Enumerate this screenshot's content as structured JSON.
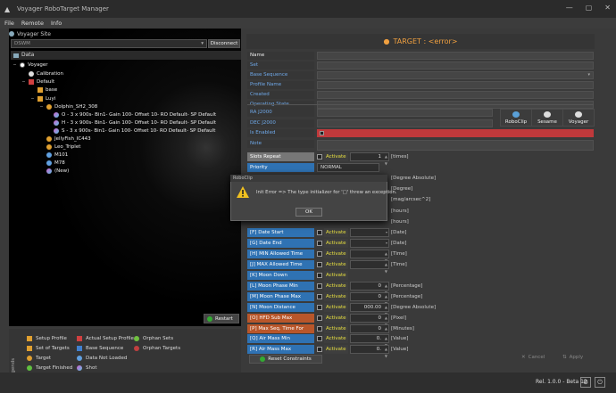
{
  "window": {
    "title": "Voyager RoboTarget Manager"
  },
  "menu": [
    "File",
    "Remote",
    "Info"
  ],
  "site": {
    "label": "Voyager Site",
    "combo_value": "DSWM",
    "disconnect_label": "Disconnect"
  },
  "data_header": "Data",
  "tree": [
    {
      "label": "Voyager",
      "indent": 0
    },
    {
      "label": "Calibration",
      "indent": 1
    },
    {
      "label": "Default",
      "indent": 1
    },
    {
      "label": "base",
      "indent": 2
    },
    {
      "label": "Luyi",
      "indent": 2
    },
    {
      "label": "Dolphin_SH2_308",
      "indent": 3
    },
    {
      "label": "O - 3 x 900s- Bin1- Gain 100- Offset 10- RO Default- SP Default",
      "indent": 4
    },
    {
      "label": "H - 3 x 900s- Bin1- Gain 100- Offset 10- RO Default- SP Default",
      "indent": 4
    },
    {
      "label": "S - 3 x 900s- Bin1- Gain 100- Offset 10- RO Default- SP Default",
      "indent": 4
    },
    {
      "label": "JellyFish_IC443",
      "indent": 3
    },
    {
      "label": "Leo_Triplet",
      "indent": 3
    },
    {
      "label": "M101",
      "indent": 3
    },
    {
      "label": "M78",
      "indent": 3
    },
    {
      "label": "(New)",
      "indent": 3
    }
  ],
  "restart_label": "Restart",
  "legend": {
    "title": "Legends",
    "items": [
      {
        "label": "Setup Profile",
        "color": "#e0a030"
      },
      {
        "label": "Actual Setup Profile",
        "color": "#d04040"
      },
      {
        "label": "Orphan Sets",
        "color": "#70c040"
      },
      {
        "label": "Set of Targets",
        "color": "#e0a030"
      },
      {
        "label": "Base Sequence",
        "color": "#4080d0"
      },
      {
        "label": "Orphan Targets",
        "color": "#c04040"
      },
      {
        "label": "Target",
        "color": "#e0a030"
      },
      {
        "label": "Data Not Loaded",
        "color": "#60a0e0"
      },
      {
        "label": "Target Finished",
        "color": "#60c040"
      },
      {
        "label": "Shot",
        "color": "#d060d0"
      }
    ]
  },
  "target_header": "TARGET : <error>",
  "fields": [
    {
      "label": "Name",
      "white": true
    },
    {
      "label": "Set",
      "white": false
    },
    {
      "label": "Base Sequence",
      "white": false
    },
    {
      "label": "Profile Name",
      "white": false
    },
    {
      "label": "Created",
      "white": false
    },
    {
      "label": "Operating State",
      "white": false
    }
  ],
  "coords": {
    "ra": "RA J2000",
    "dec": "DEC J2000"
  },
  "tools": [
    "RoboClip",
    "Sesame",
    "Voyager"
  ],
  "is_enabled": "Is Enabled",
  "note": "Note",
  "slots_repeat": {
    "label": "Slots Repeat",
    "activate": "Activate",
    "value": "1",
    "unit": "[times]"
  },
  "priority": {
    "label": "Priority",
    "value": "NORMAL"
  },
  "hidden_units": [
    "[Degree Absolute]",
    "[Degree]",
    "[mag/arcsec^2]",
    "[hours]",
    "[hours]"
  ],
  "constraints": [
    {
      "label": "[F] Date Start",
      "activate": "Activate",
      "value": "",
      "unit": "[Date]",
      "style": "blue"
    },
    {
      "label": "[G] Date End",
      "activate": "Activate",
      "value": "",
      "unit": "[Date]",
      "style": "blue"
    },
    {
      "label": "[H] MIN Allowed Time Start",
      "activate": "Activate",
      "value": "",
      "unit": "[Time]",
      "style": "blue"
    },
    {
      "label": "[J] MAX Allowed Time Start",
      "activate": "Activate",
      "value": "",
      "unit": "[Time]",
      "style": "blue"
    },
    {
      "label": "[K] Moon Down",
      "activate": "Activate",
      "value": "",
      "unit": "",
      "style": "blue"
    },
    {
      "label": "[L] Moon Phase Min",
      "activate": "Activate",
      "value": "0",
      "unit": "[Percentage]",
      "style": "blue"
    },
    {
      "label": "[M] Moon Phase Max",
      "activate": "Activate",
      "value": "0",
      "unit": "[Percentage]",
      "style": "blue"
    },
    {
      "label": "[N] Moon Distance",
      "activate": "Activate",
      "value": "000.00",
      "unit": "[Degree Absolute]",
      "style": "blue"
    },
    {
      "label": "[O] HFD Sub Max",
      "activate": "Activate",
      "value": "0",
      "unit": "[Pixel]",
      "style": "orange"
    },
    {
      "label": "[P] Max Seq. Time For Night",
      "activate": "Activate",
      "value": "0",
      "unit": "[Minutes]",
      "style": "orange"
    },
    {
      "label": "[Q] Air Mass Min",
      "activate": "Activate",
      "value": "0.",
      "unit": "[Value]",
      "style": "blue"
    },
    {
      "label": "[R] Air Mass Max",
      "activate": "Activate",
      "value": "0.",
      "unit": "[Value]",
      "style": "blue"
    }
  ],
  "reset_label": "Reset Constraints",
  "cancel_label": "Cancel",
  "apply_label": "Apply",
  "version": "Rel. 1.0.0 - Beta 12",
  "dialog": {
    "title": "RoboClip",
    "message": "Init Error => The type initializer for '□' threw an exception.",
    "ok": "OK"
  }
}
